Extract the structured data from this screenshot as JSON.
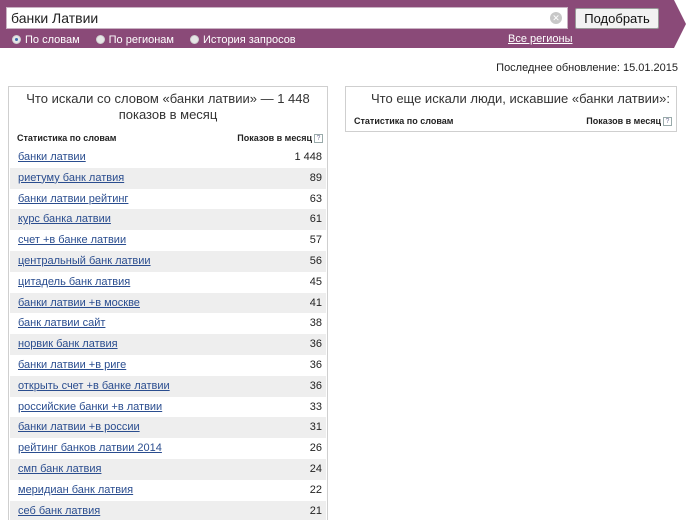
{
  "search": {
    "query": "банки Латвии",
    "submit_label": "Подобрать"
  },
  "modes": [
    {
      "label": "По словам",
      "checked": true
    },
    {
      "label": "По регионам",
      "checked": false
    },
    {
      "label": "История запросов",
      "checked": false
    }
  ],
  "all_regions_label": "Все регионы",
  "updated_text": "Последнее обновление: 15.01.2015",
  "left_panel": {
    "title": "Что искали со словом «банки латвии» — 1 448 показов в месяц",
    "col_keyword": "Статистика по словам",
    "col_count": "Показов в месяц",
    "rows": [
      {
        "keyword": "банки латвии",
        "count": "1 448"
      },
      {
        "keyword": "риетуму банк латвия",
        "count": "89"
      },
      {
        "keyword": "банки латвии рейтинг",
        "count": "63"
      },
      {
        "keyword": "курс банка латвии",
        "count": "61"
      },
      {
        "keyword": "счет +в банке латвии",
        "count": "57"
      },
      {
        "keyword": "центральный банк латвии",
        "count": "56"
      },
      {
        "keyword": "цитадель банк латвия",
        "count": "45"
      },
      {
        "keyword": "банки латвии +в москве",
        "count": "41"
      },
      {
        "keyword": "банк латвии сайт",
        "count": "38"
      },
      {
        "keyword": "норвик банк латвия",
        "count": "36"
      },
      {
        "keyword": "банки латвии +в риге",
        "count": "36"
      },
      {
        "keyword": "открыть счет +в банке латвии",
        "count": "36"
      },
      {
        "keyword": "российские банки +в латвии",
        "count": "33"
      },
      {
        "keyword": "банки латвии +в россии",
        "count": "31"
      },
      {
        "keyword": "рейтинг банков латвии 2014",
        "count": "26"
      },
      {
        "keyword": "смп банк латвия",
        "count": "24"
      },
      {
        "keyword": "меридиан банк латвия",
        "count": "22"
      },
      {
        "keyword": "себ банк латвия",
        "count": "21"
      }
    ]
  },
  "right_panel": {
    "title": "Что еще искали люди, искавшие «банки латвии»:",
    "col_keyword": "Статистика по словам",
    "col_count": "Показов в месяц"
  },
  "colors": {
    "topbar": "#8a4a78",
    "link": "#2a4d8f",
    "row_alt": "#eeeeee"
  }
}
